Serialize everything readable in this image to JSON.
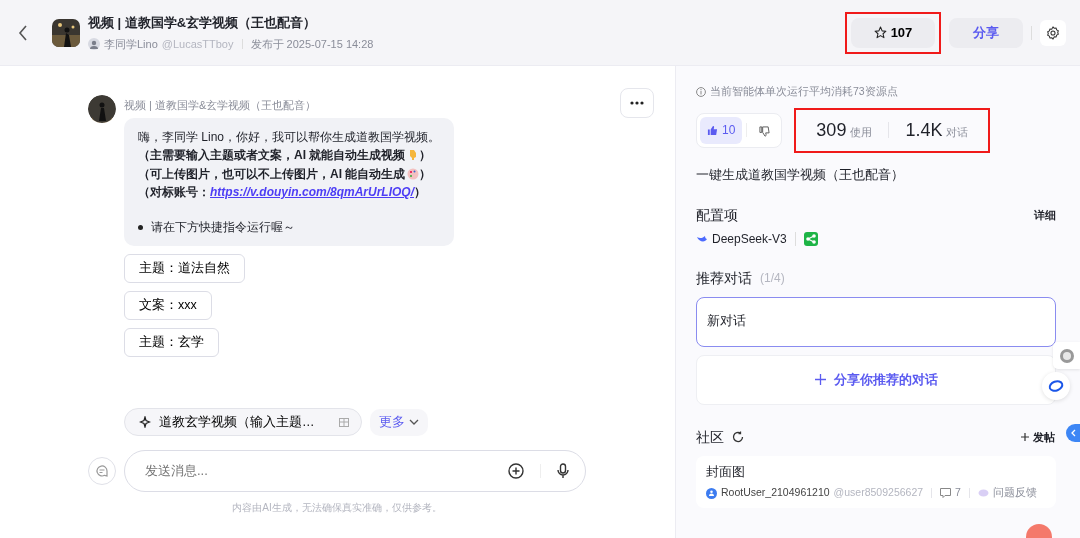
{
  "header": {
    "title": "视频 | 道教国学&玄学视频（王也配音）",
    "author_name": "李同学Lino",
    "author_handle": "@LucasTTboy",
    "published": "发布于 2025-07-15 14:28",
    "star_count": "107",
    "star_highlighted": true,
    "share_label": "分享"
  },
  "chat": {
    "bot_name": "视频 | 道教国学&玄学视频（王也配音）",
    "message": [
      {
        "kind": "plain",
        "text": "嗨，李同学 Lino，你好，我可以帮你生成道教国学视频。"
      },
      {
        "kind": "hand",
        "text": "（主需要输入主题或者文案，AI 就能自动生成视频",
        "after": "）"
      },
      {
        "kind": "palette",
        "text": "（可上传图片，也可以不上传图片，AI 能自动生成",
        "after": "）"
      },
      {
        "kind": "link",
        "text": "（对标账号：",
        "link": "https://v.douyin.com/8qmArUrLIOQ/",
        "after": "）"
      }
    ],
    "bullet": "请在下方快捷指令运行喔～",
    "quick_replies": [
      "主题：道法自然",
      "文案：xxx",
      "主题：玄学"
    ],
    "shortcut": "道教玄学视频（输入主题…",
    "more_label": "更多",
    "input_placeholder": "发送消息...",
    "disclaimer": "内容由AI生成，无法确保真实准确，仅供参考。"
  },
  "panel": {
    "cost_note": "当前智能体单次运行平均消耗73资源点",
    "likes": "10",
    "liked": true,
    "stats": [
      {
        "value": "309",
        "label": "使用"
      },
      {
        "value": "1.4K",
        "label": "对话"
      }
    ],
    "stats_highlighted": true,
    "description": "一键生成道教国学视频（王也配音）",
    "config_title": "配置项",
    "detail_label": "详细",
    "model": "DeepSeek-V3",
    "recommend_title": "推荐对话",
    "recommend_count": "(1/4)",
    "conversations": [
      {
        "title": "新对话",
        "selected": true
      }
    ],
    "share_conversation": "分享你推荐的对话",
    "community_title": "社区",
    "post_label": "发帖",
    "posts": [
      {
        "title": "封面图",
        "author": "RootUser_2104961210",
        "handle": "@user8509256627",
        "comments": "7",
        "tag": "问题反馈"
      }
    ]
  }
}
